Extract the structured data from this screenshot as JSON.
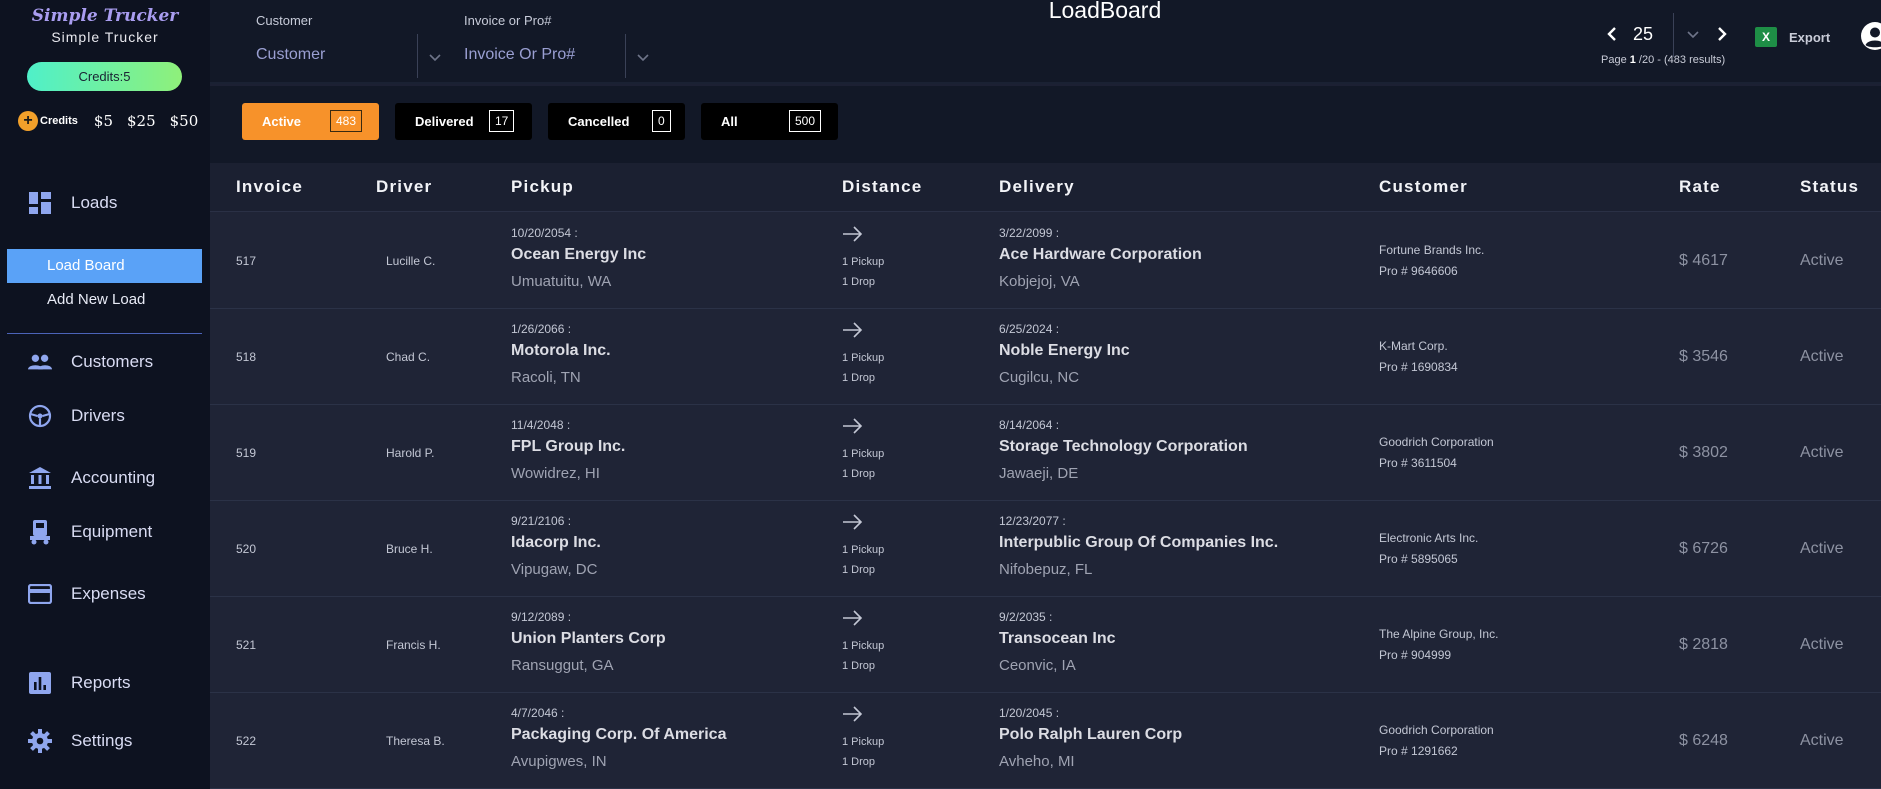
{
  "brand": {
    "script": "Simple Trucker",
    "name": "Simple Trucker"
  },
  "credits": {
    "pill": "Credits:5",
    "buy_label": "Credits",
    "amounts": [
      "$5",
      "$25",
      "$50"
    ]
  },
  "nav": {
    "loads": "Loads",
    "load_board": "Load Board",
    "add_new_load": "Add New Load",
    "customers": "Customers",
    "drivers": "Drivers",
    "accounting": "Accounting",
    "equipment": "Equipment",
    "expenses": "Expenses",
    "reports": "Reports",
    "settings": "Settings"
  },
  "filters": {
    "customer_label": "Customer",
    "customer_placeholder": "Customer",
    "invoice_label": "Invoice or Pro#",
    "invoice_placeholder": "Invoice Or Pro#"
  },
  "title": "LoadBoard",
  "pager": {
    "page_size": "25",
    "info_prefix": "Page ",
    "info_page": "1",
    "info_suffix": " /20 - (483 results)"
  },
  "export_label": "Export",
  "tabs": [
    {
      "label": "Active",
      "count": "483"
    },
    {
      "label": "Delivered",
      "count": "17"
    },
    {
      "label": "Cancelled",
      "count": "0"
    },
    {
      "label": "All",
      "count": "500"
    }
  ],
  "columns": [
    "Invoice",
    "Driver",
    "Pickup",
    "Distance",
    "Delivery",
    "Customer",
    "Rate",
    "Status"
  ],
  "rows": [
    {
      "invoice": "517",
      "driver": "Lucille C.",
      "pickup_date": "10/20/2054 :",
      "pickup_company": "Ocean Energy Inc",
      "pickup_city": "Umuatuitu, WA",
      "pickups": "1 Pickup",
      "drops": "1 Drop",
      "delivery_date": "3/22/2099 :",
      "delivery_company": "Ace Hardware Corporation",
      "delivery_city": "Kobjejoj, VA",
      "customer": "Fortune Brands Inc.",
      "pro": "Pro # 9646606",
      "rate": "$ 4617",
      "status": "Active"
    },
    {
      "invoice": "518",
      "driver": "Chad C.",
      "pickup_date": "1/26/2066 :",
      "pickup_company": "Motorola Inc.",
      "pickup_city": "Racoli, TN",
      "pickups": "1 Pickup",
      "drops": "1 Drop",
      "delivery_date": "6/25/2024 :",
      "delivery_company": "Noble Energy Inc",
      "delivery_city": "Cugilcu, NC",
      "customer": "K-Mart Corp.",
      "pro": "Pro # 1690834",
      "rate": "$ 3546",
      "status": "Active"
    },
    {
      "invoice": "519",
      "driver": "Harold P.",
      "pickup_date": "11/4/2048 :",
      "pickup_company": "FPL Group Inc.",
      "pickup_city": "Wowidrez, HI",
      "pickups": "1 Pickup",
      "drops": "1 Drop",
      "delivery_date": "8/14/2064 :",
      "delivery_company": "Storage Technology Corporation",
      "delivery_city": "Jawaeji, DE",
      "customer": "Goodrich Corporation",
      "pro": "Pro # 3611504",
      "rate": "$ 3802",
      "status": "Active"
    },
    {
      "invoice": "520",
      "driver": "Bruce H.",
      "pickup_date": "9/21/2106 :",
      "pickup_company": "Idacorp Inc.",
      "pickup_city": "Vipugaw, DC",
      "pickups": "1 Pickup",
      "drops": "1 Drop",
      "delivery_date": "12/23/2077 :",
      "delivery_company": "Interpublic Group Of Companies Inc.",
      "delivery_city": "Nifobepuz, FL",
      "customer": "Electronic Arts Inc.",
      "pro": "Pro # 5895065",
      "rate": "$ 6726",
      "status": "Active"
    },
    {
      "invoice": "521",
      "driver": "Francis H.",
      "pickup_date": "9/12/2089 :",
      "pickup_company": "Union Planters Corp",
      "pickup_city": "Ransuggut, GA",
      "pickups": "1 Pickup",
      "drops": "1 Drop",
      "delivery_date": "9/2/2035 :",
      "delivery_company": "Transocean Inc",
      "delivery_city": "Ceonvic, IA",
      "customer": "The Alpine Group, Inc.",
      "pro": "Pro # 904999",
      "rate": "$ 2818",
      "status": "Active"
    },
    {
      "invoice": "522",
      "driver": "Theresa B.",
      "pickup_date": "4/7/2046 :",
      "pickup_company": "Packaging Corp. Of America",
      "pickup_city": "Avupigwes, IN",
      "pickups": "1 Pickup",
      "drops": "1 Drop",
      "delivery_date": "1/20/2045 :",
      "delivery_company": "Polo Ralph Lauren Corp",
      "delivery_city": "Avheho, MI",
      "customer": "Goodrich Corporation",
      "pro": "Pro # 1291662",
      "rate": "$ 6248",
      "status": "Active"
    }
  ]
}
